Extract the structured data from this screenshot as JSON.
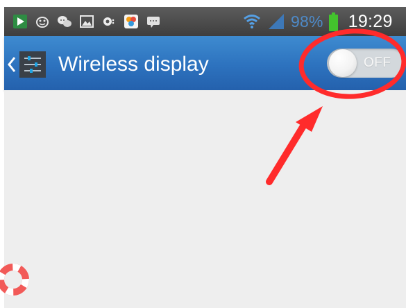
{
  "status_bar": {
    "battery_percent": "98%",
    "time": "19:29",
    "colors": {
      "background": "#4a4a4a",
      "accent": "#4e8ac8",
      "battery": "#43c32d"
    },
    "icons": [
      "media-play-icon",
      "bug-icon",
      "chat-bubbles-icon",
      "image-icon",
      "camera-icon",
      "app-icon",
      "message-icon",
      "wifi-icon",
      "signal-icon",
      "battery-icon"
    ]
  },
  "action_bar": {
    "title": "Wireless display",
    "back_icon": "chevron-left-icon",
    "app_icon": "settings-app-icon",
    "toggle": {
      "state": "OFF",
      "label": "OFF"
    },
    "colors": {
      "background": "#2d72be",
      "text": "#ffffff",
      "toggle_track": "#d3d8dc"
    }
  },
  "content": {
    "help_icon": "lifebuoy-icon",
    "background": "#eeeeee"
  },
  "annotation": {
    "shape_icon": "red-ellipse-highlight",
    "arrow_icon": "red-arrow",
    "color": "#ff2b2b"
  }
}
